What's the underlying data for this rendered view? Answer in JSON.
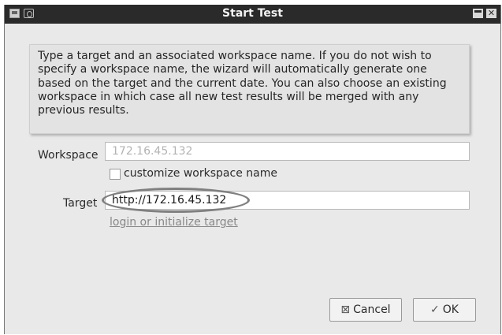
{
  "window": {
    "title": "Start Test"
  },
  "info_text": "Type a target and an associated workspace name. If you do not wish to specify a workspace name, the wizard will automatically generate one based on the target and the current date. You can also choose an existing workspace in which case all new test results will be merged with any previous results.",
  "workspace": {
    "label": "Workspace",
    "placeholder": "172.16.45.132",
    "value": ""
  },
  "customize": {
    "label": "customize workspace name",
    "checked": false
  },
  "target": {
    "label": "Target",
    "value": "http://172.16.45.132"
  },
  "link": {
    "label": "login or initialize target"
  },
  "buttons": {
    "cancel": "Cancel",
    "ok": "OK"
  },
  "icons": {
    "app": "app-icon",
    "menu": "window-menu-icon",
    "maximize": "maximize-icon",
    "close": "close-icon",
    "cancel": "cancel-x-icon",
    "ok": "checkmark-icon"
  },
  "colors": {
    "titlebar": "#2a2a2a",
    "dialog_bg": "#e9e9e9",
    "annotation": "#808080"
  }
}
